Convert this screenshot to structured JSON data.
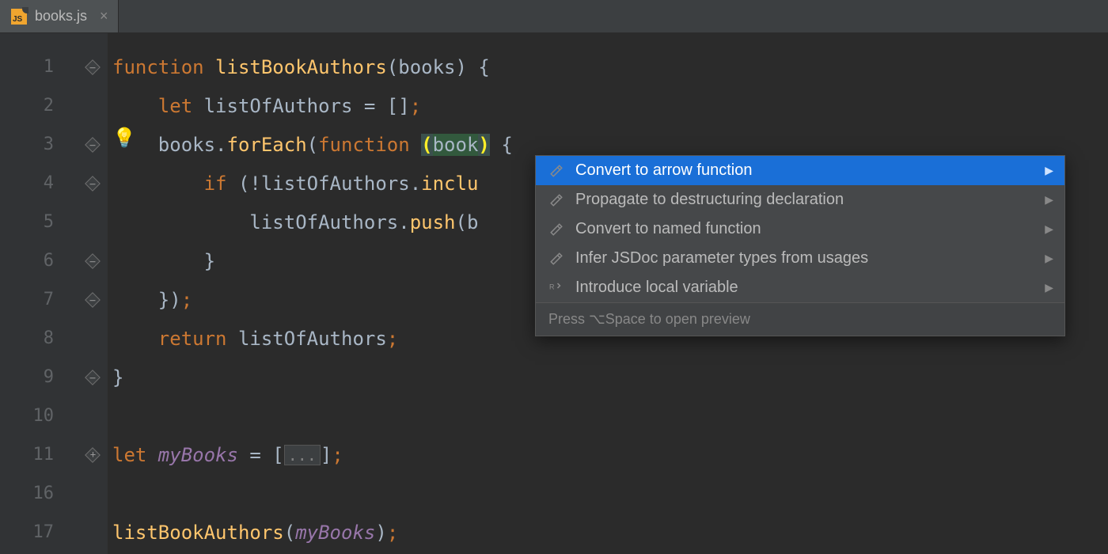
{
  "tab": {
    "filename": "books.js"
  },
  "gutter": {
    "lines": [
      "1",
      "2",
      "3",
      "4",
      "5",
      "6",
      "7",
      "8",
      "9",
      "10",
      "11",
      "16",
      "17"
    ]
  },
  "code": {
    "l1": {
      "kw_function": "function ",
      "fn": "listBookAuthors",
      "p1": "(",
      "param": "books",
      "p2": ") ",
      "brace": "{"
    },
    "l2": {
      "indent": "    ",
      "kw_let": "let ",
      "var": "listOfAuthors ",
      "eq": "= ",
      "arr": "[]",
      "semi": ";"
    },
    "l3": {
      "indent": "    ",
      "obj": "books",
      "dot": ".",
      "fn": "forEach",
      "p1": "(",
      "kw_function": "function ",
      "ph1": "(",
      "param": "book",
      "ph2": ")",
      "sp": " ",
      "brace": "{"
    },
    "l4": {
      "indent": "        ",
      "kw_if": "if ",
      "p1": "(",
      "bang": "!",
      "var": "listOfAuthors",
      "dot": ".",
      "fn": "inclu"
    },
    "l5": {
      "indent": "            ",
      "var": "listOfAuthors",
      "dot": ".",
      "fn": "push",
      "p1": "(",
      "arg": "b"
    },
    "l6": {
      "indent": "        ",
      "brace": "}"
    },
    "l7": {
      "indent": "    ",
      "brace": "}",
      "p2": ")",
      "semi": ";"
    },
    "l8": {
      "indent": "    ",
      "kw_return": "return ",
      "var": "listOfAuthors",
      "semi": ";"
    },
    "l9": {
      "brace": "}"
    },
    "l10": {
      "blank": ""
    },
    "l11": {
      "kw_let": "let ",
      "var": "myBooks ",
      "eq": "= ",
      "b1": "[",
      "ell": "...",
      "b2": "]",
      "semi": ";"
    },
    "l16": {
      "blank": ""
    },
    "l17": {
      "fn": "listBookAuthors",
      "p1": "(",
      "arg": "myBooks",
      "p2": ")",
      "semi": ";"
    }
  },
  "intentions": {
    "items": [
      {
        "label": "Convert to arrow function",
        "icon": "pencil",
        "selected": true
      },
      {
        "label": "Propagate to destructuring declaration",
        "icon": "pencil",
        "selected": false
      },
      {
        "label": "Convert to named function",
        "icon": "pencil",
        "selected": false
      },
      {
        "label": "Infer JSDoc parameter types from usages",
        "icon": "pencil",
        "selected": false
      },
      {
        "label": "Introduce local variable",
        "icon": "refactor",
        "selected": false
      }
    ],
    "footer": "Press ⌥Space to open preview"
  }
}
